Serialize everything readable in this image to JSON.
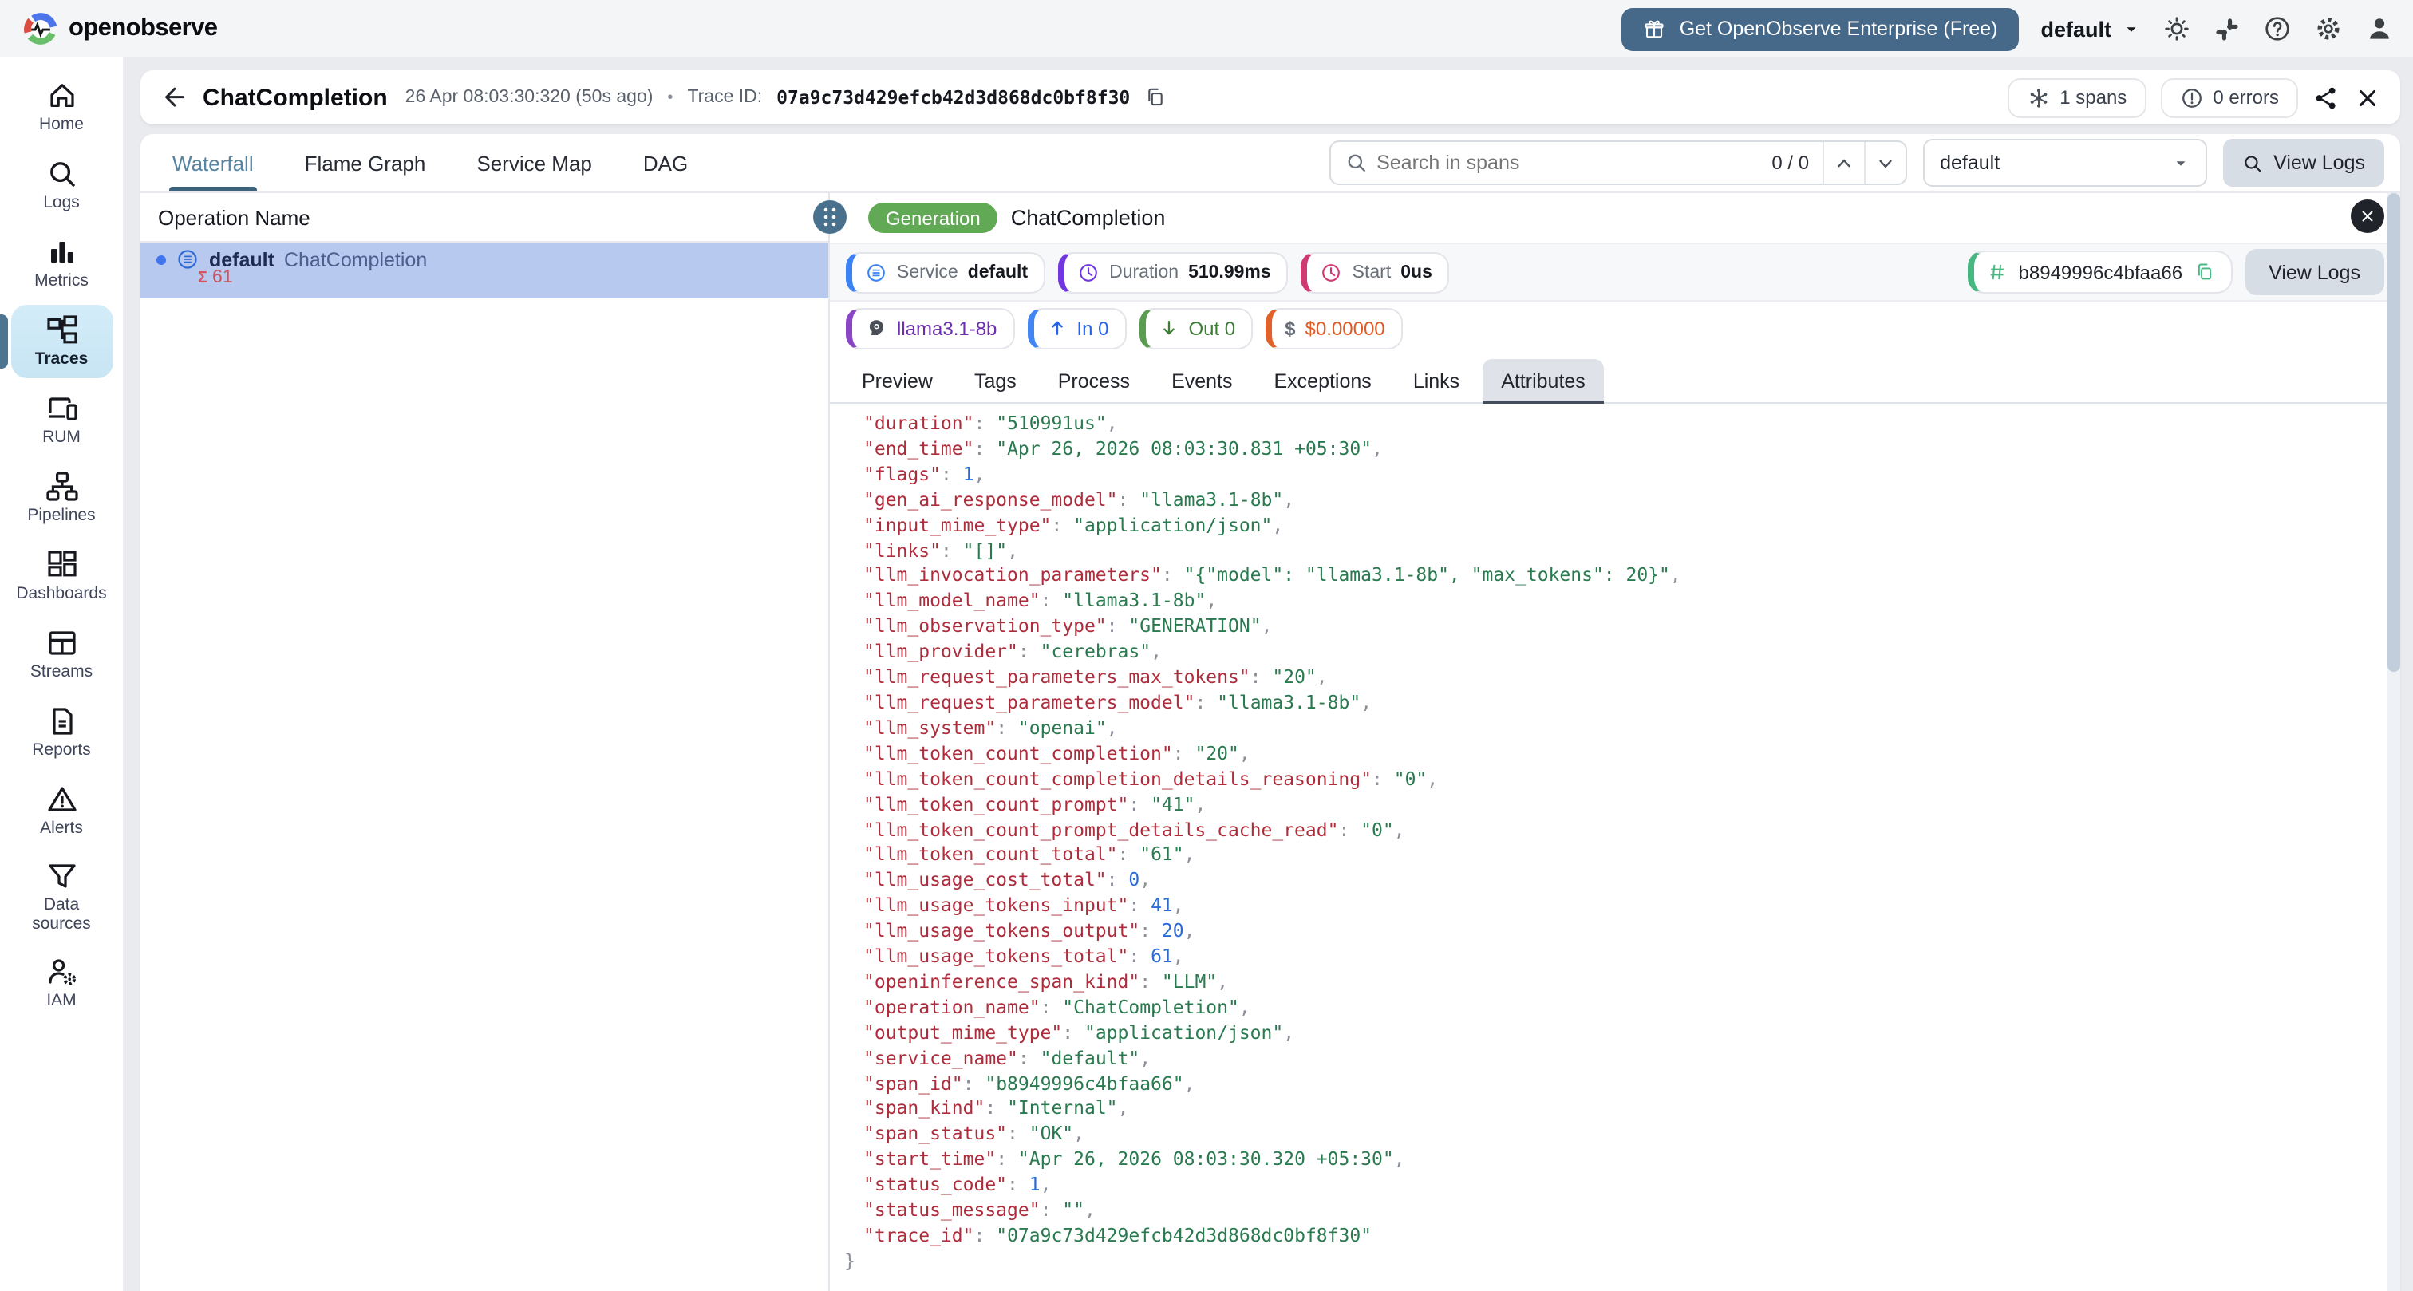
{
  "topbar": {
    "brand": "openobserve",
    "enterprise_button": "Get OpenObserve Enterprise (Free)",
    "org_selector": "default",
    "icons": [
      "theme-icon",
      "slack-icon",
      "help-icon",
      "settings-icon",
      "account-icon"
    ]
  },
  "sidebar": {
    "items": [
      {
        "label": "Home",
        "icon": "i-home",
        "active": false
      },
      {
        "label": "Logs",
        "icon": "i-search",
        "active": false
      },
      {
        "label": "Metrics",
        "icon": "i-metrics",
        "active": false
      },
      {
        "label": "Traces",
        "icon": "i-traces",
        "active": true
      },
      {
        "label": "RUM",
        "icon": "i-rum",
        "active": false
      },
      {
        "label": "Pipelines",
        "icon": "i-pipelines",
        "active": false
      },
      {
        "label": "Dashboards",
        "icon": "i-dashboards",
        "active": false
      },
      {
        "label": "Streams",
        "icon": "i-streams",
        "active": false
      },
      {
        "label": "Reports",
        "icon": "i-reports",
        "active": false
      },
      {
        "label": "Alerts",
        "icon": "i-alerts",
        "active": false
      },
      {
        "label": "Data sources",
        "icon": "i-funnel",
        "active": false
      },
      {
        "label": "IAM",
        "icon": "i-iam",
        "active": false
      }
    ]
  },
  "trace_header": {
    "title": "ChatCompletion",
    "timestamp": "26 Apr 08:03:30:320 (50s ago)",
    "separator": "•",
    "trace_id_label": "Trace ID:",
    "trace_id": "07a9c73d429efcb42d3d868dc0bf8f30",
    "spans_count": "1 spans",
    "errors_count": "0 errors"
  },
  "view_tabs": [
    {
      "label": "Waterfall",
      "active": true
    },
    {
      "label": "Flame Graph",
      "active": false
    },
    {
      "label": "Service Map",
      "active": false
    },
    {
      "label": "DAG",
      "active": false
    }
  ],
  "span_search": {
    "placeholder": "Search in spans",
    "counter": "0 / 0"
  },
  "stream_selector": "default",
  "view_logs_label": "View Logs",
  "waterfall": {
    "column_header": "Operation Name",
    "row": {
      "service": "default",
      "operation": "ChatCompletion",
      "sigma": "Σ",
      "tokens_total": "61"
    }
  },
  "span_detail": {
    "kind_badge": "Generation",
    "title": "ChatCompletion",
    "service_label": "Service",
    "service_value": "default",
    "duration_label": "Duration",
    "duration_value": "510.99ms",
    "start_label": "Start",
    "start_value": "0us",
    "span_id": "b8949996c4bfaa66",
    "view_logs_label": "View Logs",
    "model_value": "llama3.1-8b",
    "tokens_in": "In 0",
    "tokens_out": "Out 0",
    "dollar_glyph": "$",
    "cost_value": "$0.00000",
    "tabs": [
      {
        "label": "Preview",
        "active": false
      },
      {
        "label": "Tags",
        "active": false
      },
      {
        "label": "Process",
        "active": false
      },
      {
        "label": "Events",
        "active": false
      },
      {
        "label": "Exceptions",
        "active": false
      },
      {
        "label": "Links",
        "active": false
      },
      {
        "label": "Attributes",
        "active": true
      }
    ],
    "attributes": [
      {
        "key": "duration",
        "value": "510991us",
        "type": "string"
      },
      {
        "key": "end_time",
        "value": "Apr 26, 2026 08:03:30.831 +05:30",
        "type": "string"
      },
      {
        "key": "flags",
        "value": "1",
        "type": "number"
      },
      {
        "key": "gen_ai_response_model",
        "value": "llama3.1-8b",
        "type": "string"
      },
      {
        "key": "input_mime_type",
        "value": "application/json",
        "type": "string"
      },
      {
        "key": "links",
        "value": "[]",
        "type": "string"
      },
      {
        "key": "llm_invocation_parameters",
        "value": "{\"model\": \"llama3.1-8b\", \"max_tokens\": 20}",
        "type": "string"
      },
      {
        "key": "llm_model_name",
        "value": "llama3.1-8b",
        "type": "string"
      },
      {
        "key": "llm_observation_type",
        "value": "GENERATION",
        "type": "string"
      },
      {
        "key": "llm_provider",
        "value": "cerebras",
        "type": "string"
      },
      {
        "key": "llm_request_parameters_max_tokens",
        "value": "20",
        "type": "string"
      },
      {
        "key": "llm_request_parameters_model",
        "value": "llama3.1-8b",
        "type": "string"
      },
      {
        "key": "llm_system",
        "value": "openai",
        "type": "string"
      },
      {
        "key": "llm_token_count_completion",
        "value": "20",
        "type": "string"
      },
      {
        "key": "llm_token_count_completion_details_reasoning",
        "value": "0",
        "type": "string"
      },
      {
        "key": "llm_token_count_prompt",
        "value": "41",
        "type": "string"
      },
      {
        "key": "llm_token_count_prompt_details_cache_read",
        "value": "0",
        "type": "string"
      },
      {
        "key": "llm_token_count_total",
        "value": "61",
        "type": "string"
      },
      {
        "key": "llm_usage_cost_total",
        "value": "0",
        "type": "number"
      },
      {
        "key": "llm_usage_tokens_input",
        "value": "41",
        "type": "number"
      },
      {
        "key": "llm_usage_tokens_output",
        "value": "20",
        "type": "number"
      },
      {
        "key": "llm_usage_tokens_total",
        "value": "61",
        "type": "number"
      },
      {
        "key": "openinference_span_kind",
        "value": "LLM",
        "type": "string"
      },
      {
        "key": "operation_name",
        "value": "ChatCompletion",
        "type": "string"
      },
      {
        "key": "output_mime_type",
        "value": "application/json",
        "type": "string"
      },
      {
        "key": "service_name",
        "value": "default",
        "type": "string"
      },
      {
        "key": "span_id",
        "value": "b8949996c4bfaa66",
        "type": "string"
      },
      {
        "key": "span_kind",
        "value": "Internal",
        "type": "string"
      },
      {
        "key": "span_status",
        "value": "OK",
        "type": "string"
      },
      {
        "key": "start_time",
        "value": "Apr 26, 2026 08:03:30.320 +05:30",
        "type": "string"
      },
      {
        "key": "status_code",
        "value": "1",
        "type": "number"
      },
      {
        "key": "status_message",
        "value": "",
        "type": "string"
      },
      {
        "key": "trace_id",
        "value": "07a9c73d429efcb42d3d868dc0bf8f30",
        "type": "string"
      }
    ],
    "attributes_closing": "}"
  },
  "colors": {
    "enterprise_button": "#46698a",
    "active_tab": "#5684a2",
    "tab_underline": "#3c627e",
    "selected_row": "#b8c9f0",
    "sidebar_active": "#cde9f7",
    "generation_badge": "#62a955",
    "service_accent": "#3b82f6",
    "duration_accent": "#7136e0",
    "start_accent": "#cf3a72",
    "span_id_accent": "#47b881",
    "model_accent": "#8b46c8",
    "in_accent": "#4285f4",
    "out_accent": "#5b9c50",
    "cost_accent": "#e0622a",
    "json_key": "#ae2d3c",
    "json_string": "#2a7a4f",
    "json_number": "#2b6bd8"
  }
}
